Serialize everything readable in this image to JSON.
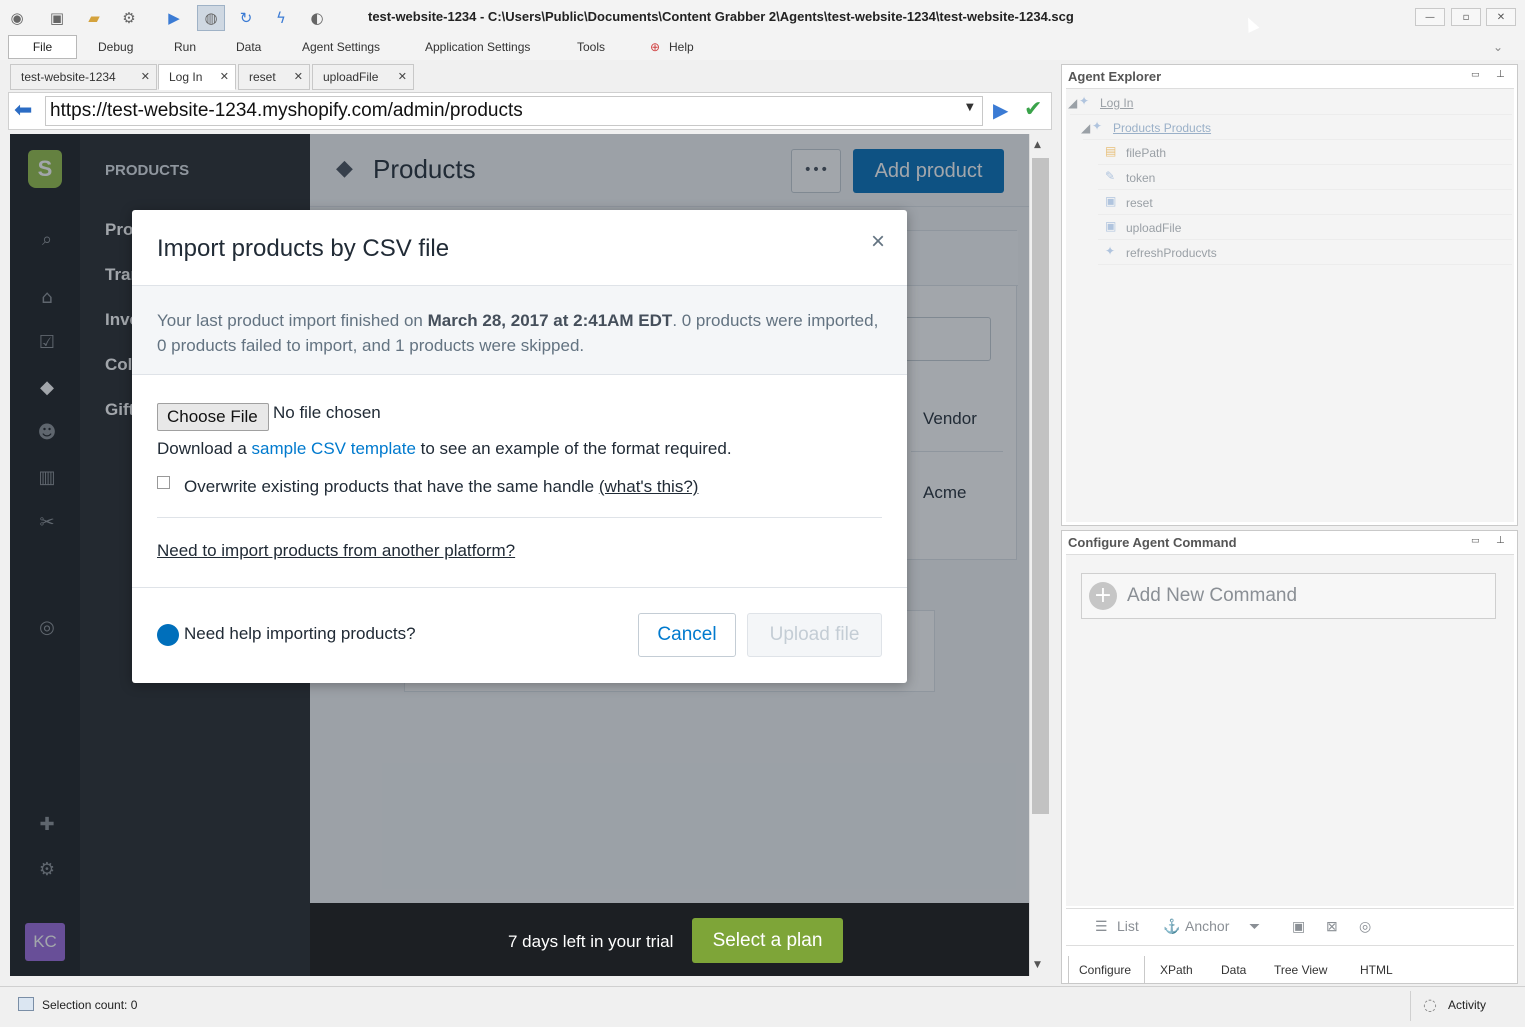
{
  "window": {
    "title": "test-website-1234 - C:\\Users\\Public\\Documents\\Content Grabber 2\\Agents\\test-website-1234\\test-website-1234.scg",
    "controls": [
      "minimize-icon",
      "maximize-icon",
      "close-icon"
    ]
  },
  "menu": {
    "items": [
      "File",
      "Debug",
      "Run",
      "Data",
      "Agent Settings",
      "Application Settings",
      "Tools",
      "Help"
    ]
  },
  "doc_tabs": [
    {
      "label": "test-website-1234"
    },
    {
      "label": "Log In"
    },
    {
      "label": "reset"
    },
    {
      "label": "uploadFile"
    }
  ],
  "address": {
    "url": "https://test-website-1234.myshopify.com/admin/products"
  },
  "shopify": {
    "nav_header": "PRODUCTS",
    "nav_items": [
      "Pro",
      "Tran",
      "Inve",
      "Col",
      "Gift"
    ],
    "page_title": "Products",
    "more_button": "•••",
    "add_product": "Add product",
    "bg_vendor_label": "Vendor",
    "bg_vendor_value": "Acme",
    "avatar_initials": "KC",
    "trial_text": "7 days left in your trial",
    "plan_button": "Select a plan"
  },
  "modal": {
    "title": "Import products by CSV file",
    "close": "×",
    "note_prefix": "Your last product import finished on ",
    "note_date": "March 28, 2017 at 2:41AM EDT",
    "note_suffix": ". 0 products were imported, 0 products failed to import, and 1 products were skipped.",
    "choose_file": "Choose File",
    "file_status": "No file chosen",
    "download_prefix": "Download a ",
    "download_link": "sample CSV template",
    "download_suffix": " to see an example of the format required.",
    "overwrite_label": "Overwrite existing products that have the same handle ",
    "overwrite_link": "(what's this?)",
    "platform_link": "Need to import products from another platform?",
    "help_text": "Need help importing products?",
    "cancel": "Cancel",
    "upload": "Upload file"
  },
  "agent_explorer": {
    "title": "Agent Explorer",
    "tree": [
      {
        "label": "Log In",
        "underline": true
      },
      {
        "label": "Products Products",
        "underline": true
      },
      {
        "label": "filePath"
      },
      {
        "label": "token"
      },
      {
        "label": "reset"
      },
      {
        "label": "uploadFile"
      },
      {
        "label": "refreshProducvts"
      }
    ]
  },
  "configure": {
    "title": "Configure Agent Command",
    "add_command": "Add New Command",
    "toolbar": {
      "list": "List",
      "anchor": "Anchor"
    },
    "tabs": [
      "Configure",
      "XPath",
      "Data",
      "Tree View",
      "HTML"
    ]
  },
  "status": {
    "selection": "Selection count: 0",
    "activity": "Activity"
  },
  "colors": {
    "shopify_blue": "#006fbb",
    "shopify_green": "#7ea538",
    "shopify_dark": "#1c1f23",
    "link_blue": "#007ace"
  }
}
